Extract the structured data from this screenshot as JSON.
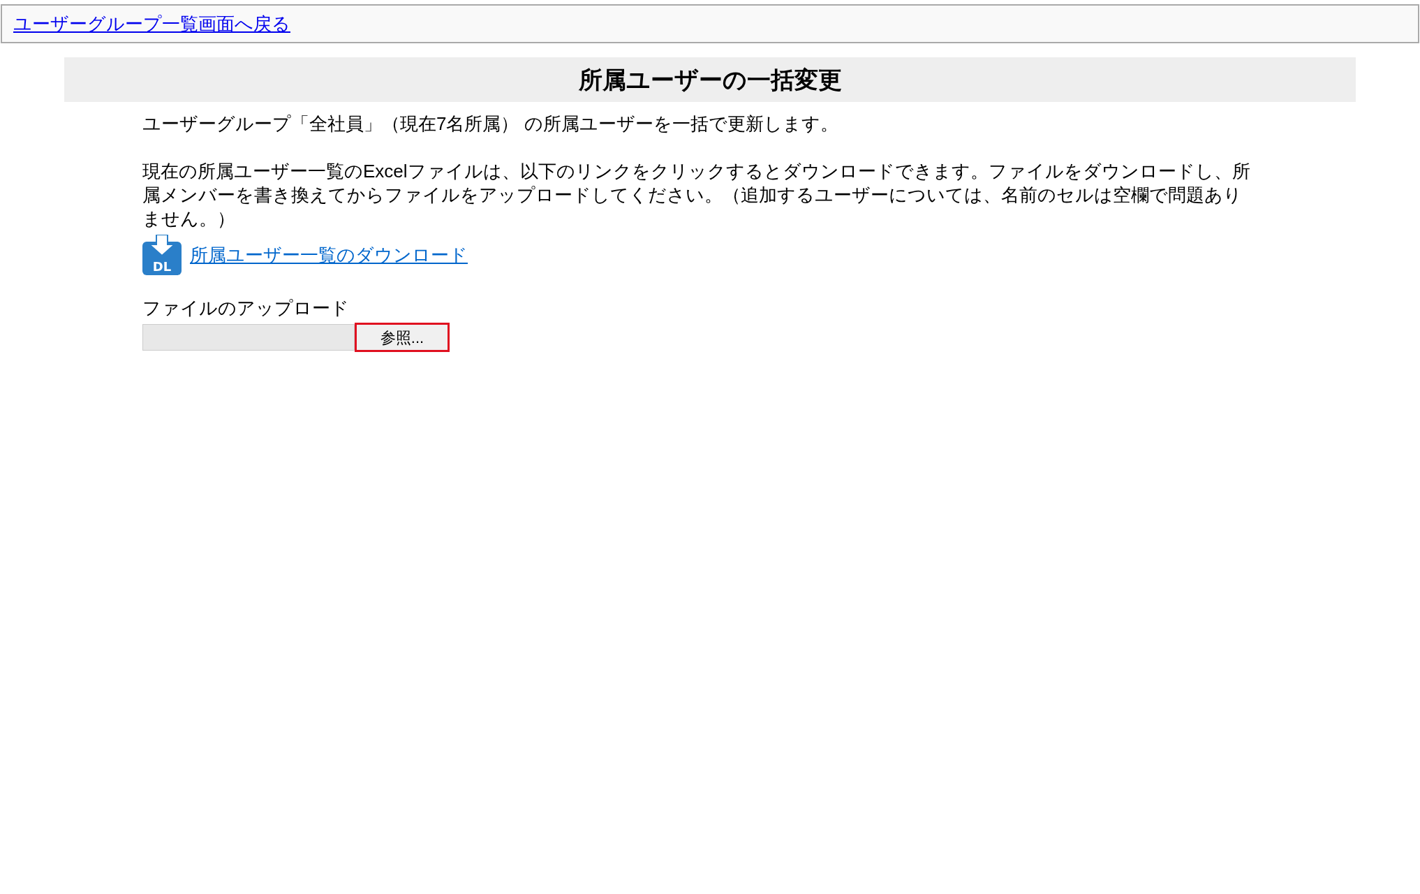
{
  "top_bar": {
    "back_link": "ユーザーグループ一覧画面へ戻る"
  },
  "title": "所属ユーザーの一括変更",
  "intro": "ユーザーグループ「全社員」（現在7名所属） の所属ユーザーを一括で更新します。",
  "instructions": "現在の所属ユーザー一覧のExcelファイルは、以下のリンクをクリックするとダウンロードできます。ファイルをダウンロードし、所属メンバーを書き換えてからファイルをアップロードしてください。（追加するユーザーについては、名前のセルは空欄で問題ありません。）",
  "download": {
    "icon_label": "DL",
    "link": "所属ユーザー一覧のダウンロード"
  },
  "upload": {
    "label": "ファイルのアップロード",
    "browse_button": "参照...",
    "highlighted": true
  }
}
